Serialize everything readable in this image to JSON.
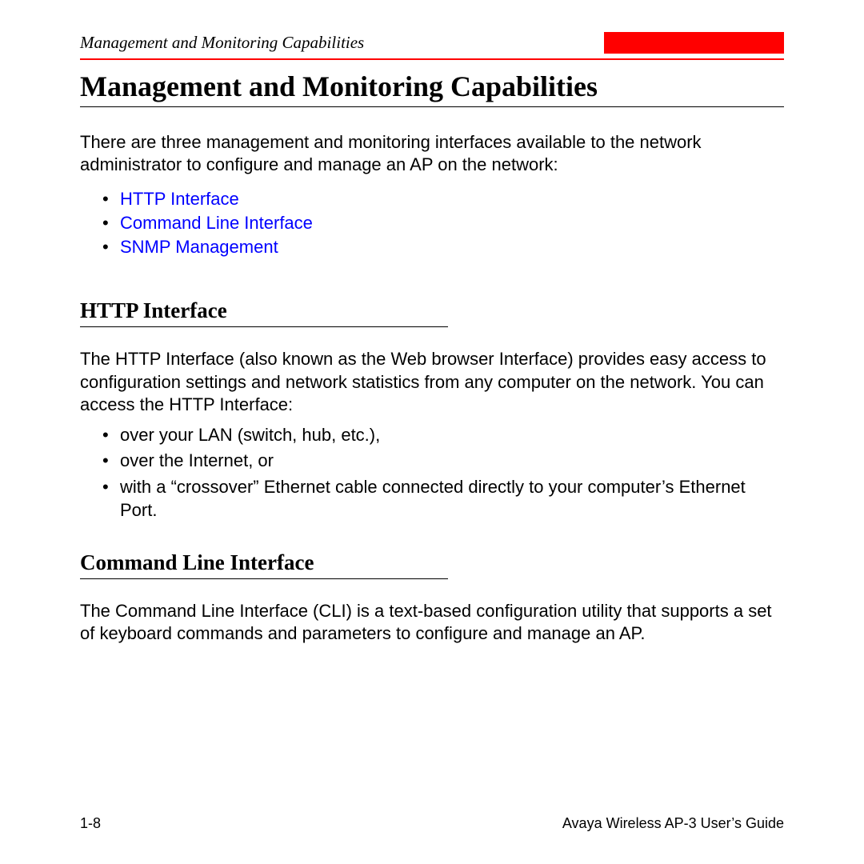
{
  "header": {
    "running_head": "Management and Monitoring Capabilities"
  },
  "title": "Management and Monitoring Capabilities",
  "intro": "There are three management and monitoring interfaces available to the network administrator to configure and manage an AP on the network:",
  "links": {
    "item1": "HTTP Interface",
    "item2": "Command Line Interface",
    "item3": "SNMP Management"
  },
  "section1": {
    "heading": "HTTP Interface",
    "body": "The HTTP Interface (also known as the Web browser Interface) provides easy access to configuration settings and network statistics from any computer on the network. You can access the HTTP Interface:",
    "bullets": {
      "b1": "over your LAN (switch, hub, etc.),",
      "b2": "over the Internet, or",
      "b3": "with a “crossover” Ethernet cable connected directly to your computer’s Ethernet Port."
    }
  },
  "section2": {
    "heading": "Command Line Interface",
    "body": "The Command Line Interface (CLI) is a text-based configuration utility that supports a set of keyboard commands and parameters to configure and manage an AP."
  },
  "footer": {
    "page_num": "1-8",
    "guide": "Avaya Wireless AP-3 User’s Guide"
  }
}
